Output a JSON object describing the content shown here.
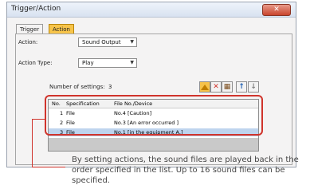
{
  "window": {
    "title": "Trigger/Action",
    "close_glyph": "✕"
  },
  "tabs": [
    {
      "label": "Trigger"
    },
    {
      "label": "Action"
    }
  ],
  "form": {
    "action_label": "Action:",
    "action_value": "Sound Output",
    "action_type_label": "Action Type:",
    "action_type_value": "Play",
    "settings_label": "Number of settings:",
    "settings_count": "3"
  },
  "toolbar": {
    "icons": [
      "add-icon",
      "delete-icon",
      "settings-icon",
      "move-up-icon",
      "move-down-icon"
    ],
    "move_up_glyph": "↑",
    "move_down_glyph": "↓"
  },
  "table": {
    "columns": [
      "No.",
      "Specification",
      "File No./Device"
    ],
    "rows": [
      {
        "no": "1",
        "spec": "File",
        "file": "No.4 [Caution]"
      },
      {
        "no": "2",
        "spec": "File",
        "file": "No.3 [An error occurred ]"
      },
      {
        "no": "3",
        "spec": "File",
        "file": "No.1 [in the equipment A.]"
      }
    ],
    "selected_row": 3
  },
  "caption": "By setting actions, the sound files are played back in the order specified in the list. Up to 16 sound files can be specified.",
  "colors": {
    "highlight": "#d0342c",
    "active_tab": "#f7c44a",
    "selected_row": "#bed4ee"
  }
}
